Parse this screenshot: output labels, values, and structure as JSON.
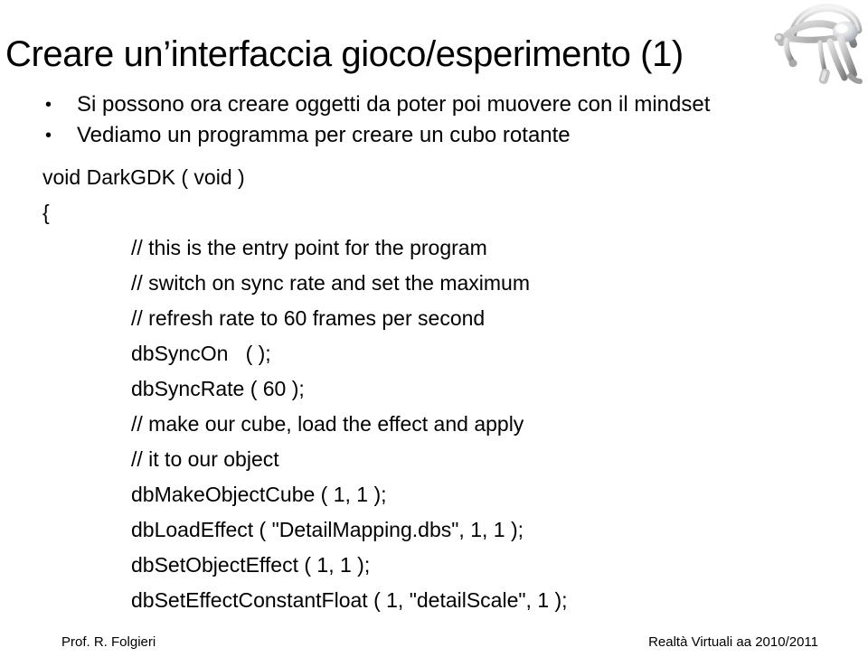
{
  "slide": {
    "title": "Creare un’interfaccia gioco/esperimento (1)",
    "bullets": [
      {
        "marker": "•",
        "text": "Si possono ora creare oggetti da poter poi muovere con il mindset"
      },
      {
        "marker": "•",
        "text": "Vediamo un programma per creare un cubo rotante"
      }
    ],
    "code_lines": [
      {
        "indent": 0,
        "text": "void DarkGDK ( void )"
      },
      {
        "indent": 0,
        "text": "{"
      },
      {
        "indent": 1,
        "text": "// this is the entry point for the program"
      },
      {
        "indent": 1,
        "text": "// switch on sync rate and set the maximum"
      },
      {
        "indent": 1,
        "text": "// refresh rate to 60 frames per second"
      },
      {
        "indent": 1,
        "text": "dbSyncOn   ( );"
      },
      {
        "indent": 1,
        "text": "dbSyncRate ( 60 );"
      },
      {
        "indent": 1,
        "text": "// make our cube, load the effect and apply"
      },
      {
        "indent": 1,
        "text": "// it to our object"
      },
      {
        "indent": 1,
        "text": "dbMakeObjectCube ( 1, 1 );"
      },
      {
        "indent": 1,
        "text": "dbLoadEffect ( \"DetailMapping.dbs\", 1, 1 );"
      },
      {
        "indent": 1,
        "text": "dbSetObjectEffect ( 1, 1 );"
      },
      {
        "indent": 1,
        "text": "dbSetEffectConstantFloat ( 1, \"detailScale\", 1 );"
      }
    ],
    "image": {
      "name": "mindset-headset-image",
      "alt": "EEG mindset headset"
    },
    "footer": {
      "left": "Prof. R. Folgieri",
      "right": "Realtà Virtuali aa 2010/2011"
    },
    "colors": {
      "background": "#ffffff",
      "text": "#000000",
      "headset_light": "#e8e8e8",
      "headset_mid": "#b8b8b8",
      "headset_dark": "#8a8a8a"
    }
  }
}
